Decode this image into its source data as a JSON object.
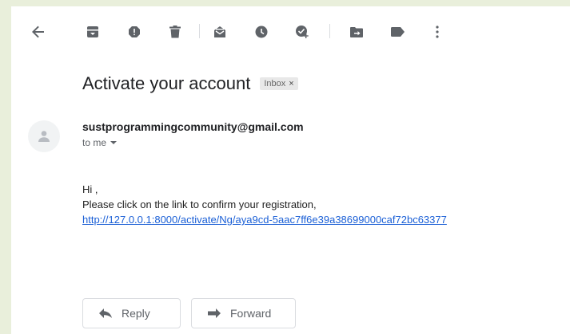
{
  "email": {
    "subject": "Activate your account",
    "label": "Inbox",
    "label_remove": "×",
    "sender": "sustprogrammingcommunity@gmail.com",
    "recipient": "to me",
    "greeting": "Hi ,",
    "message": "Please click on the link to confirm your registration,",
    "link": "http://127.0.0.1:8000/activate/Ng/aya9cd-5aac7ff6e39a38699000caf72bc63377"
  },
  "actions": {
    "reply_label": "Reply",
    "forward_label": "Forward"
  },
  "toolbar": {
    "icons": [
      "back-arrow-icon",
      "archive-icon",
      "report-spam-icon",
      "delete-icon",
      "mark-unread-icon",
      "snooze-icon",
      "add-to-tasks-icon",
      "move-to-icon",
      "labels-icon",
      "more-options-icon"
    ]
  },
  "colors": {
    "link": "#1a5fd6",
    "background": "#e9efdb"
  }
}
